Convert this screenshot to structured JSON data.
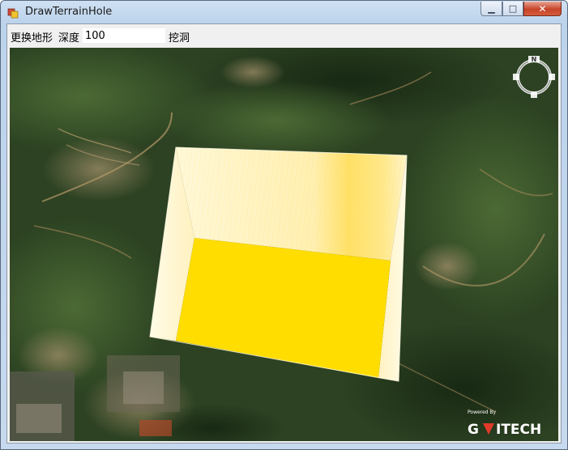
{
  "window": {
    "title": "DrawTerrainHole",
    "minimize_glyph": "▁",
    "maximize_glyph": "□",
    "close_glyph": "✕"
  },
  "toolbar": {
    "change_terrain_label": "更换地形",
    "depth_label": "深度",
    "depth_value": "100",
    "dig_label": "挖洞"
  },
  "viewport": {
    "compass_letter": "N",
    "brand_powered": "Powered By",
    "brand_name": "G",
    "brand_name_rest": "ITECH",
    "hole_color": "#ffdd00",
    "hole_wall_light": "#fff6c8",
    "hole_wall_mid": "#ffe680",
    "terrain_dark": "#1f3418",
    "terrain_mid": "#3d5a2c"
  }
}
